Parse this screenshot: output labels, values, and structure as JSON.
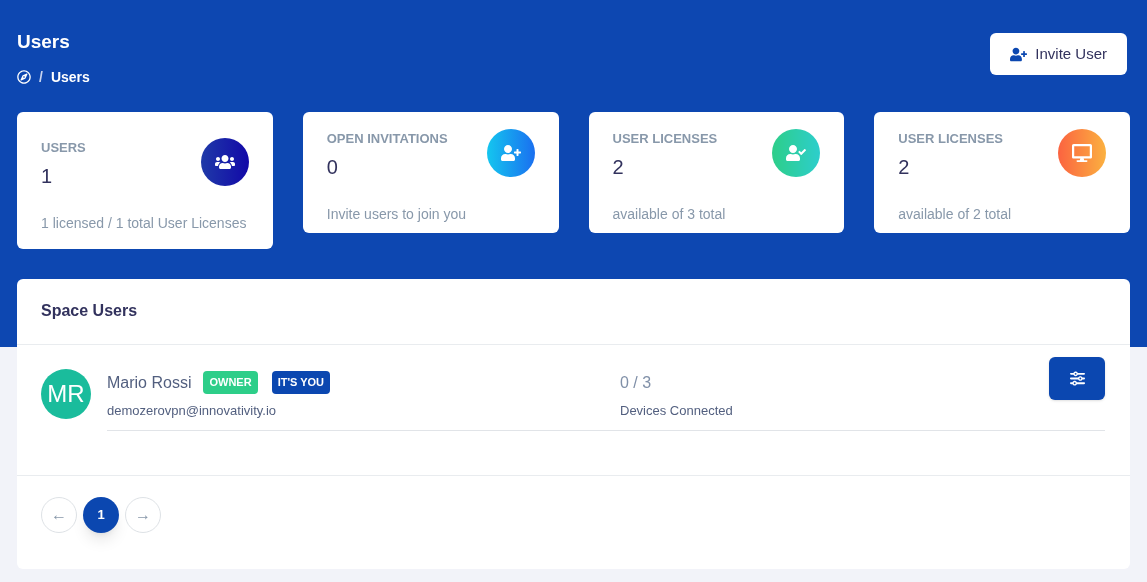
{
  "page": {
    "title": "Users",
    "breadcrumb_separator": "/",
    "breadcrumb": "Users",
    "invite_button": "Invite User"
  },
  "stats": [
    {
      "kind": "users",
      "label": "USERS",
      "value": "1",
      "note": "1 licensed / 1 total User Licenses"
    },
    {
      "kind": "invite",
      "label": "OPEN INVITATIONS",
      "value": "0",
      "note": "Invite users to join you"
    },
    {
      "kind": "check",
      "label": "USER LICENSES",
      "value": "2",
      "note": "available of 3 total"
    },
    {
      "kind": "monitor",
      "label": "USER LICENSES",
      "value": "2",
      "note": "available of 2 total"
    }
  ],
  "space_users": {
    "title": "Space Users",
    "rows": [
      {
        "initials": "MR",
        "name": "Mario Rossi",
        "email": "demozerovpn@innovativity.io",
        "badges": [
          {
            "kind": "owner",
            "label": "OWNER"
          },
          {
            "kind": "you",
            "label": "IT'S YOU"
          }
        ],
        "devices": "0 / 3",
        "devices_label": "Devices Connected"
      }
    ]
  },
  "pagination": {
    "prev": "←",
    "next": "→",
    "pages": [
      {
        "label": "1",
        "selected": true
      }
    ]
  }
}
